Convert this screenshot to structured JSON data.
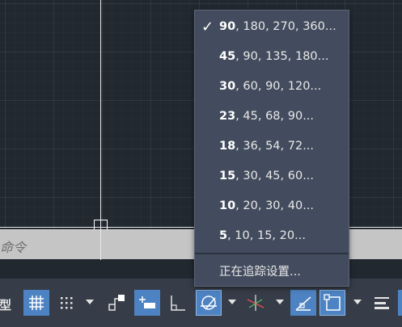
{
  "command_line": {
    "prompt_text": "命令"
  },
  "status_bar": {
    "model_label": "模型"
  },
  "polar_menu": {
    "items": [
      {
        "first": "90",
        "rest": ", 180, 270, 360...",
        "checked": true
      },
      {
        "first": "45",
        "rest": ", 90, 135, 180...",
        "checked": false
      },
      {
        "first": "30",
        "rest": ", 60, 90, 120...",
        "checked": false
      },
      {
        "first": "23",
        "rest": ", 45, 68, 90...",
        "checked": false
      },
      {
        "first": "18",
        "rest": ", 36, 54, 72...",
        "checked": false
      },
      {
        "first": "15",
        "rest": ", 30, 45, 60...",
        "checked": false
      },
      {
        "first": "10",
        "rest": ", 20, 30, 40...",
        "checked": false
      },
      {
        "first": "5",
        "rest": ", 10, 15, 20...",
        "checked": false
      }
    ],
    "check_mark": "✓",
    "settings_label": "正在追踪设置..."
  },
  "icons": {
    "grid": "grid-icon",
    "snap": "snap-icon",
    "infer": "infer-constraints-icon",
    "dynamic_input": "dynamic-input-icon",
    "ortho": "ortho-icon",
    "polar": "polar-tracking-icon",
    "isodraft": "isodraft-icon",
    "object_snap_tracking": "object-snap-tracking-icon",
    "object_snap": "object-snap-icon",
    "lineweight": "lineweight-icon"
  },
  "colors": {
    "canvas_bg": "#212830",
    "menu_bg": "#434c5e",
    "active_button": "#4e83c3",
    "statusbar_bg": "#363d48",
    "command_line_bg": "#c5c5c5"
  }
}
